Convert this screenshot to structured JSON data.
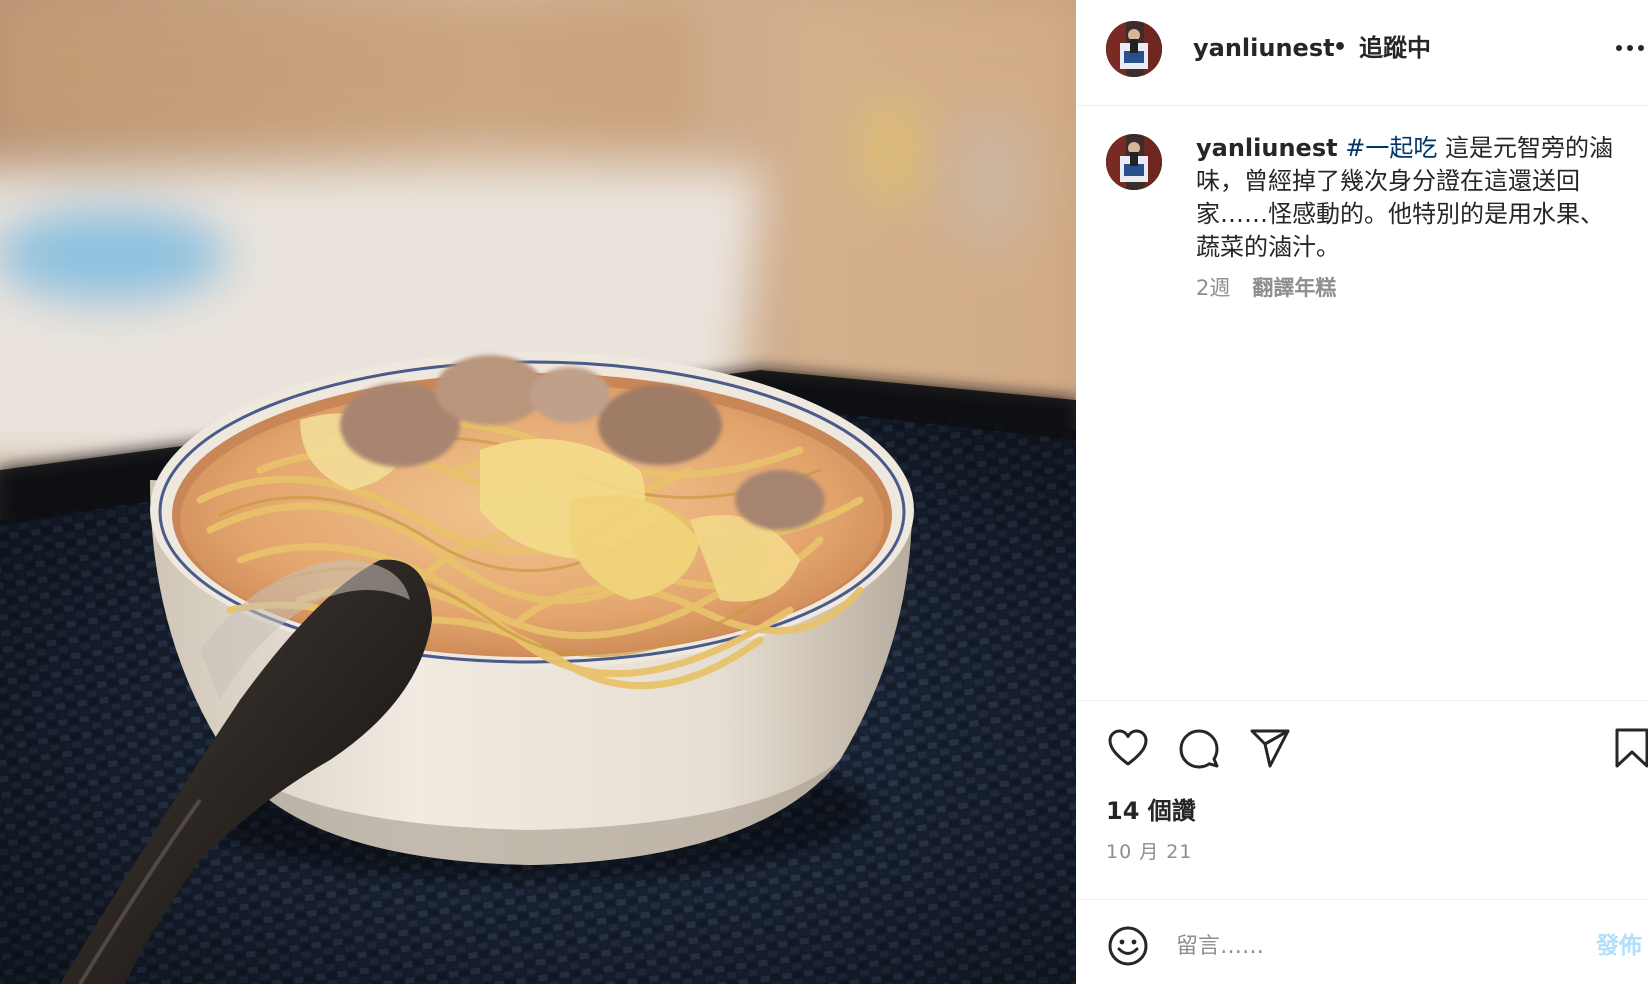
{
  "post": {
    "username": "yanliunest",
    "follow_status": "追蹤中",
    "separator": "•",
    "caption": {
      "username": "yanliunest",
      "hashtag": "#一起吃",
      "text": "這是元智旁的滷味，曾經掉了幾次身分證在這還送回家……怪感動的。他特別的是用水果、蔬菜的滷汁。"
    },
    "time_ago": "2週",
    "translate_label": "翻譯年糕",
    "likes": "14 個讚",
    "date": "10 月 21",
    "comment": {
      "placeholder": "留言……",
      "post_label": "發佈"
    }
  },
  "icons": {
    "more": "more-options-icon",
    "like": "heart-icon",
    "comment": "comment-bubble-icon",
    "share": "paper-plane-icon",
    "save": "bookmark-icon",
    "emoji": "smiley-face-icon"
  },
  "colors": {
    "text": "#262626",
    "secondary": "#8e8e8e",
    "hashtag": "#00376b",
    "post_button_disabled": "#b2dffc",
    "divider": "#efefef"
  }
}
